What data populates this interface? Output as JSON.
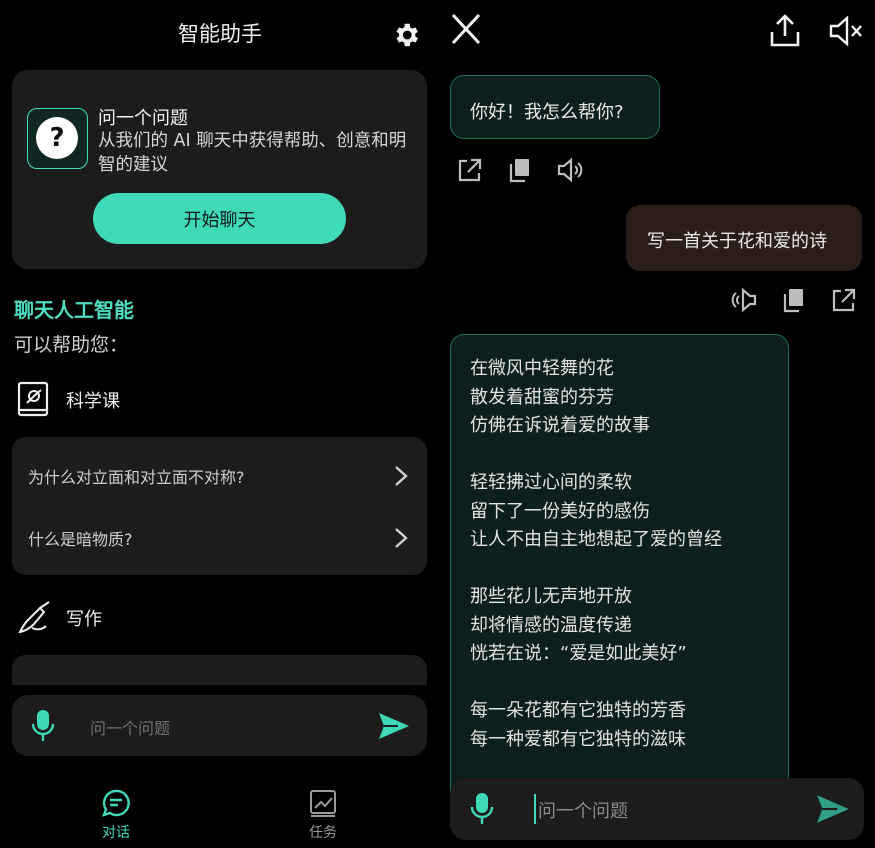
{
  "left": {
    "header_title": "智能助手",
    "ask_card": {
      "title": "问一个问题",
      "description": "从我们的 AI 聊天中获得帮助、创意和明智的建议",
      "button": "开始聊天"
    },
    "section_title": "聊天人工智能",
    "section_subtitle": "可以帮助您：",
    "categories": [
      {
        "label": "科学课",
        "icon": "science-book-icon"
      },
      {
        "label": "写作",
        "icon": "writing-hand-icon"
      }
    ],
    "science_questions": [
      "为什么对立面和对立面不对称?",
      "什么是暗物质?"
    ],
    "input_placeholder": "问一个问题",
    "nav": [
      {
        "label": "对话",
        "icon": "chat-icon",
        "active": true
      },
      {
        "label": "任务",
        "icon": "chart-icon",
        "active": false
      }
    ]
  },
  "right": {
    "messages": {
      "greeting": "你好！我怎么帮你?",
      "user": "写一首关于花和爱的诗",
      "poem_lines": [
        "在微风中轻舞的花",
        "散发着甜蜜的芬芳",
        "仿佛在诉说着爱的故事",
        "",
        "轻轻拂过心间的柔软",
        "留下了一份美好的感伤",
        "让人不由自主地想起了爱的曾经",
        "",
        "那些花儿无声地开放",
        "却将情感的温度传递",
        "恍若在说：“爱是如此美好”",
        "",
        "每一朵花都有它独特的芳香",
        "每一种爱都有它独特的滋味"
      ]
    },
    "input_placeholder": "问一个问题"
  },
  "colors": {
    "accent": "#3fd9b8",
    "card_bg": "#1c1c1c",
    "ai_bubble_bg": "#0d1f1c",
    "user_bubble_bg": "#2a1d17",
    "background": "#000000"
  }
}
